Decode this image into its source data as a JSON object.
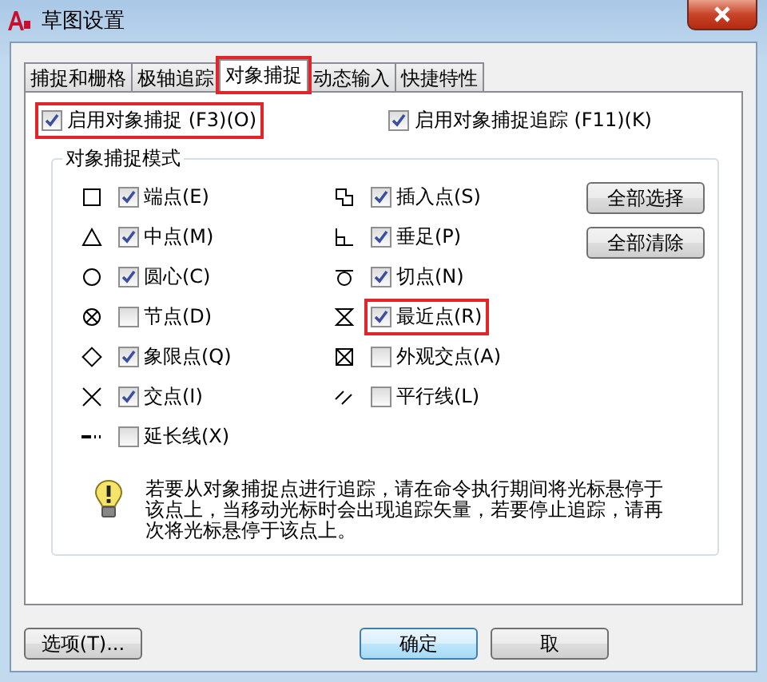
{
  "window": {
    "title": "草图设置"
  },
  "tabs": [
    {
      "label": "捕捉和栅格",
      "selected": false,
      "highlighted": false
    },
    {
      "label": "极轴追踪",
      "selected": false,
      "highlighted": false
    },
    {
      "label": "对象捕捉",
      "selected": true,
      "highlighted": true
    },
    {
      "label": "动态输入",
      "selected": false,
      "highlighted": false
    },
    {
      "label": "快捷特性",
      "selected": false,
      "highlighted": false
    }
  ],
  "toggles": [
    {
      "label": "启用对象捕捉 (F3)(O)",
      "checked": true,
      "highlighted": true
    },
    {
      "label": "启用对象捕捉追踪 (F11)(K)",
      "checked": true,
      "highlighted": false
    }
  ],
  "group": {
    "title": "对象捕捉模式",
    "left": [
      {
        "kind": "square",
        "label": "端点(E)",
        "checked": true,
        "highlighted": false
      },
      {
        "kind": "triangle",
        "label": "中点(M)",
        "checked": true,
        "highlighted": false
      },
      {
        "kind": "circle",
        "label": "圆心(C)",
        "checked": true,
        "highlighted": false
      },
      {
        "kind": "node",
        "label": "节点(D)",
        "checked": false,
        "highlighted": false
      },
      {
        "kind": "diamond",
        "label": "象限点(Q)",
        "checked": true,
        "highlighted": false
      },
      {
        "kind": "cross",
        "label": "交点(I)",
        "checked": true,
        "highlighted": false
      },
      {
        "kind": "extension",
        "label": "延长线(X)",
        "checked": false,
        "highlighted": false
      }
    ],
    "right": [
      {
        "kind": "insertion",
        "label": "插入点(S)",
        "checked": true,
        "highlighted": false
      },
      {
        "kind": "perpendicular",
        "label": "垂足(P)",
        "checked": true,
        "highlighted": false
      },
      {
        "kind": "tangent",
        "label": "切点(N)",
        "checked": true,
        "highlighted": false
      },
      {
        "kind": "nearest",
        "label": "最近点(R)",
        "checked": true,
        "highlighted": true
      },
      {
        "kind": "apparent",
        "label": "外观交点(A)",
        "checked": false,
        "highlighted": false
      },
      {
        "kind": "parallel",
        "label": "平行线(L)",
        "checked": false,
        "highlighted": false
      }
    ],
    "buttons": [
      "全部选择",
      "全部清除"
    ],
    "info": "若要从对象捕捉点进行追踪，请在命令执行期间将光标悬停于该点上，当移动光标时会出现追踪矢量，若要停止追踪，请再次将光标悬停于该点上。"
  },
  "buttons": [
    {
      "label": "选项(T)...",
      "kind": "normal"
    },
    {
      "label": "确定",
      "kind": "default"
    },
    {
      "label": "取",
      "kind": "normal"
    }
  ]
}
